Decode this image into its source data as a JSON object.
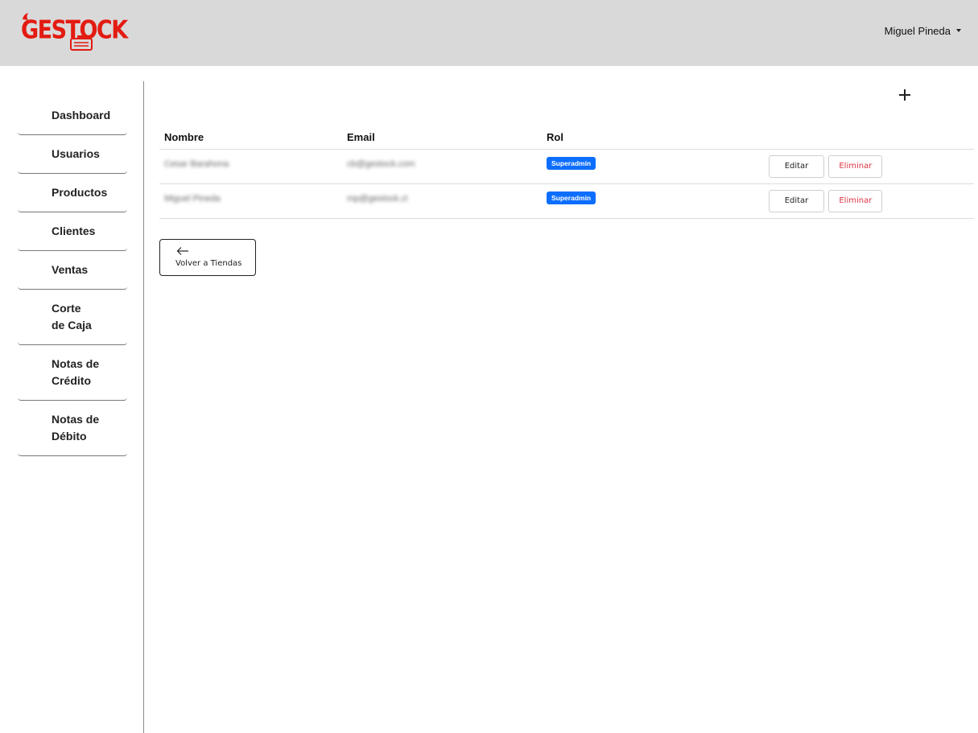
{
  "header": {
    "logo_text": "GESTOCK",
    "brand_color": "#e31b12",
    "user_name": "Miguel Pineda"
  },
  "sidebar": {
    "items": [
      {
        "label": "Dashboard"
      },
      {
        "label": "Usuarios"
      },
      {
        "label": "Productos"
      },
      {
        "label": "Clientes"
      },
      {
        "label": "Ventas"
      },
      {
        "label": "Corte de Caja"
      },
      {
        "label": "Notas de Crédito"
      },
      {
        "label": "Notas de Débito"
      }
    ]
  },
  "main": {
    "add_icon": "plus-icon",
    "table": {
      "columns": [
        "Nombre",
        "Email",
        "Rol",
        ""
      ],
      "rows": [
        {
          "nombre": "Cesar Barahona",
          "email": "cb@gestock.com",
          "rol": "Superadmin",
          "edit_label": "Editar",
          "delete_label": "Eliminar"
        },
        {
          "nombre": "Miguel Pineda",
          "email": "mp@gestock.cl",
          "rol": "Superadmin",
          "edit_label": "Editar",
          "delete_label": "Eliminar"
        }
      ]
    },
    "back_button": {
      "label": "Volver a Tiendas",
      "icon": "arrow-left-icon"
    },
    "badge_color": "#0d6efd",
    "delete_color": "#dc3545"
  }
}
